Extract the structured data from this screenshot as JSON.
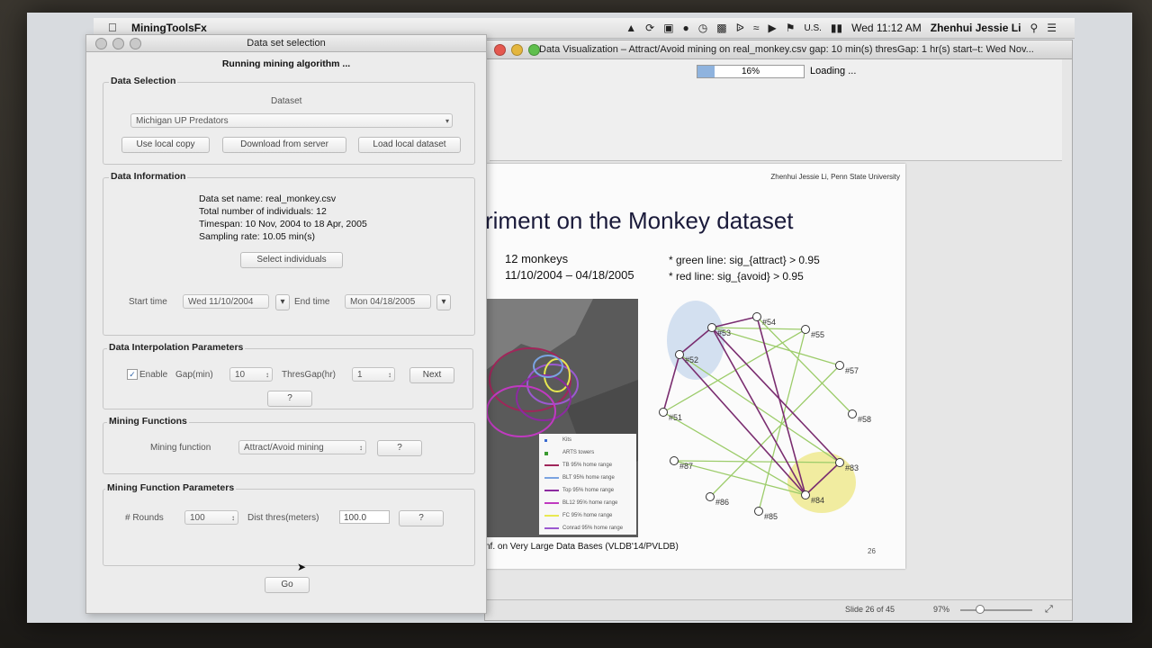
{
  "menubar": {
    "app_name": "MiningToolsFx",
    "clock": "Wed 11:12 AM",
    "user": "Zhenhui Jessie Li",
    "input_source": "U.S."
  },
  "visualization_window": {
    "title": "Data Visualization – Attract/Avoid mining on real_monkey.csv gap: 10 min(s) thresGap: 1 hr(s) start–t: Wed Nov...",
    "progress_percent": 16,
    "progress_label": "16%",
    "loading_label": "Loading ...",
    "status": {
      "slide_counter": "Slide 26 of 45",
      "zoom": "97%"
    }
  },
  "slide": {
    "author": "Zhenhui Jessie Li, Penn State University",
    "heading": "riment on the Monkey dataset",
    "bullet1": "12 monkeys",
    "bullet2": "11/10/2004 – 04/18/2005",
    "note1": "* green line: sig_{attract} > 0.95",
    "note2": "* red line: sig_{avoid} > 0.95",
    "legend": [
      "Kits",
      "ARTS towers",
      "TB 95% home range",
      "BLT 95% home range",
      "Top 95% home range",
      "BL12 95% home range",
      "FC 95% home range",
      "Conrad 95% home range"
    ],
    "nodes": [
      "#54",
      "#53",
      "#55",
      "#52",
      "#57",
      "#51",
      "#58",
      "#87",
      "#83",
      "#86",
      "#85",
      "#84"
    ],
    "footer": "nf. on Very Large Data Bases (VLDB'14/PVLDB)",
    "page_number": "26"
  },
  "dataset_window": {
    "title": "Data set selection",
    "running": "Running mining algorithm ...",
    "data_selection": {
      "group_title": "Data Selection",
      "dataset_label": "Dataset",
      "dataset_value": "Michigan UP Predators",
      "btn_local": "Use local copy",
      "btn_download": "Download from server",
      "btn_load": "Load local dataset"
    },
    "data_information": {
      "group_title": "Data Information",
      "line1": "Data set name: real_monkey.csv",
      "line2": "Total number of individuals: 12",
      "line3": "Timespan: 10 Nov, 2004 to 18 Apr, 2005",
      "line4": "Sampling rate: 10.05 min(s)",
      "btn_select": "Select individuals",
      "start_label": "Start time",
      "start_value": "Wed 11/10/2004",
      "end_label": "End time",
      "end_value": "Mon 04/18/2005"
    },
    "interpolation": {
      "group_title": "Data Interpolation Parameters",
      "enable_label": "Enable",
      "gap_label": "Gap(min)",
      "gap_value": "10",
      "thres_label": "ThresGap(hr)",
      "thres_value": "1",
      "btn_next": "Next",
      "btn_help": "?"
    },
    "mining_functions": {
      "group_title": "Mining Functions",
      "function_label": "Mining function",
      "function_value": "Attract/Avoid mining",
      "btn_help": "?"
    },
    "mining_params": {
      "group_title": "Mining Function Parameters",
      "rounds_label": "# Rounds",
      "rounds_value": "100",
      "dist_label": "Dist thres(meters)",
      "dist_value": "100.0",
      "btn_help": "?"
    },
    "btn_go": "Go"
  }
}
